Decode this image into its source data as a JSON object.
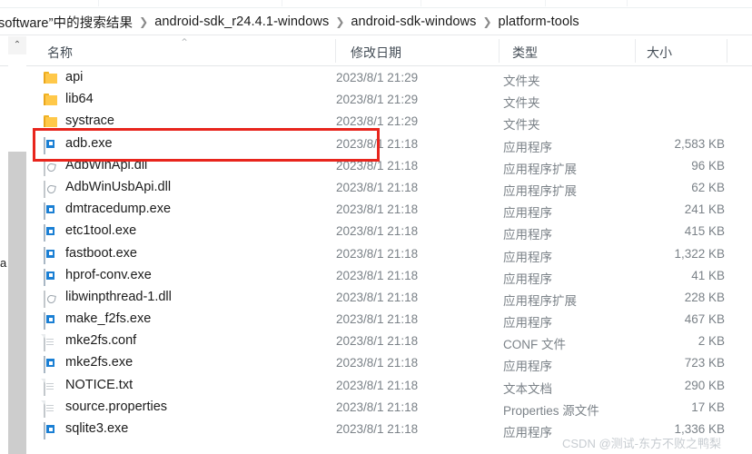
{
  "window": {
    "breadcrumb": {
      "items": [
        "software”中的搜索结果",
        "android-sdk_r24.4.1-windows",
        "android-sdk-windows",
        "platform-tools"
      ],
      "separator": "❯"
    },
    "left_fragment_text": "a",
    "scroll_up_arrow": "⌃",
    "sort_indicator": "⌃"
  },
  "columns": {
    "name": "名称",
    "date_modified": "修改日期",
    "type": "类型",
    "size": "大小"
  },
  "files": [
    {
      "icon": "folder-icon",
      "name": "api",
      "date": "2023/8/1 21:29",
      "type": "文件夹",
      "size": ""
    },
    {
      "icon": "folder-icon",
      "name": "lib64",
      "date": "2023/8/1 21:29",
      "type": "文件夹",
      "size": ""
    },
    {
      "icon": "folder-icon",
      "name": "systrace",
      "date": "2023/8/1 21:29",
      "type": "文件夹",
      "size": ""
    },
    {
      "icon": "exe-icon",
      "name": "adb.exe",
      "date": "2023/8/1 21:18",
      "type": "应用程序",
      "size": "2,583 KB"
    },
    {
      "icon": "dll-icon",
      "name": "AdbWinApi.dll",
      "date": "2023/8/1 21:18",
      "type": "应用程序扩展",
      "size": "96 KB"
    },
    {
      "icon": "dll-icon",
      "name": "AdbWinUsbApi.dll",
      "date": "2023/8/1 21:18",
      "type": "应用程序扩展",
      "size": "62 KB"
    },
    {
      "icon": "exe-icon",
      "name": "dmtracedump.exe",
      "date": "2023/8/1 21:18",
      "type": "应用程序",
      "size": "241 KB"
    },
    {
      "icon": "exe-icon",
      "name": "etc1tool.exe",
      "date": "2023/8/1 21:18",
      "type": "应用程序",
      "size": "415 KB"
    },
    {
      "icon": "exe-icon",
      "name": "fastboot.exe",
      "date": "2023/8/1 21:18",
      "type": "应用程序",
      "size": "1,322 KB"
    },
    {
      "icon": "exe-icon",
      "name": "hprof-conv.exe",
      "date": "2023/8/1 21:18",
      "type": "应用程序",
      "size": "41 KB"
    },
    {
      "icon": "dll-icon",
      "name": "libwinpthread-1.dll",
      "date": "2023/8/1 21:18",
      "type": "应用程序扩展",
      "size": "228 KB"
    },
    {
      "icon": "exe-icon",
      "name": "make_f2fs.exe",
      "date": "2023/8/1 21:18",
      "type": "应用程序",
      "size": "467 KB"
    },
    {
      "icon": "doc-icon",
      "name": "mke2fs.conf",
      "date": "2023/8/1 21:18",
      "type": "CONF 文件",
      "size": "2 KB"
    },
    {
      "icon": "exe-icon",
      "name": "mke2fs.exe",
      "date": "2023/8/1 21:18",
      "type": "应用程序",
      "size": "723 KB"
    },
    {
      "icon": "doc-icon",
      "name": "NOTICE.txt",
      "date": "2023/8/1 21:18",
      "type": "文本文档",
      "size": "290 KB"
    },
    {
      "icon": "doc-icon",
      "name": "source.properties",
      "date": "2023/8/1 21:18",
      "type": "Properties 源文件",
      "size": "17 KB"
    },
    {
      "icon": "exe-icon",
      "name": "sqlite3.exe",
      "date": "2023/8/1 21:18",
      "type": "应用程序",
      "size": "1,336 KB"
    }
  ],
  "annotation": {
    "highlight_color": "#e8251d",
    "highlighted_row": "adb.exe"
  },
  "watermark": "CSDN @测试-东方不败之鸭梨"
}
